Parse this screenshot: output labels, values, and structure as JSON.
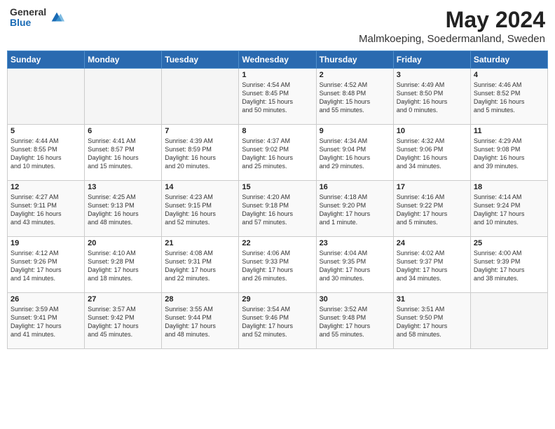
{
  "header": {
    "logo_general": "General",
    "logo_blue": "Blue",
    "month_title": "May 2024",
    "location": "Malmkoeping, Soedermanland, Sweden"
  },
  "days_of_week": [
    "Sunday",
    "Monday",
    "Tuesday",
    "Wednesday",
    "Thursday",
    "Friday",
    "Saturday"
  ],
  "weeks": [
    [
      {
        "day": "",
        "text": ""
      },
      {
        "day": "",
        "text": ""
      },
      {
        "day": "",
        "text": ""
      },
      {
        "day": "1",
        "text": "Sunrise: 4:54 AM\nSunset: 8:45 PM\nDaylight: 15 hours\nand 50 minutes."
      },
      {
        "day": "2",
        "text": "Sunrise: 4:52 AM\nSunset: 8:48 PM\nDaylight: 15 hours\nand 55 minutes."
      },
      {
        "day": "3",
        "text": "Sunrise: 4:49 AM\nSunset: 8:50 PM\nDaylight: 16 hours\nand 0 minutes."
      },
      {
        "day": "4",
        "text": "Sunrise: 4:46 AM\nSunset: 8:52 PM\nDaylight: 16 hours\nand 5 minutes."
      }
    ],
    [
      {
        "day": "5",
        "text": "Sunrise: 4:44 AM\nSunset: 8:55 PM\nDaylight: 16 hours\nand 10 minutes."
      },
      {
        "day": "6",
        "text": "Sunrise: 4:41 AM\nSunset: 8:57 PM\nDaylight: 16 hours\nand 15 minutes."
      },
      {
        "day": "7",
        "text": "Sunrise: 4:39 AM\nSunset: 8:59 PM\nDaylight: 16 hours\nand 20 minutes."
      },
      {
        "day": "8",
        "text": "Sunrise: 4:37 AM\nSunset: 9:02 PM\nDaylight: 16 hours\nand 25 minutes."
      },
      {
        "day": "9",
        "text": "Sunrise: 4:34 AM\nSunset: 9:04 PM\nDaylight: 16 hours\nand 29 minutes."
      },
      {
        "day": "10",
        "text": "Sunrise: 4:32 AM\nSunset: 9:06 PM\nDaylight: 16 hours\nand 34 minutes."
      },
      {
        "day": "11",
        "text": "Sunrise: 4:29 AM\nSunset: 9:08 PM\nDaylight: 16 hours\nand 39 minutes."
      }
    ],
    [
      {
        "day": "12",
        "text": "Sunrise: 4:27 AM\nSunset: 9:11 PM\nDaylight: 16 hours\nand 43 minutes."
      },
      {
        "day": "13",
        "text": "Sunrise: 4:25 AM\nSunset: 9:13 PM\nDaylight: 16 hours\nand 48 minutes."
      },
      {
        "day": "14",
        "text": "Sunrise: 4:23 AM\nSunset: 9:15 PM\nDaylight: 16 hours\nand 52 minutes."
      },
      {
        "day": "15",
        "text": "Sunrise: 4:20 AM\nSunset: 9:18 PM\nDaylight: 16 hours\nand 57 minutes."
      },
      {
        "day": "16",
        "text": "Sunrise: 4:18 AM\nSunset: 9:20 PM\nDaylight: 17 hours\nand 1 minute."
      },
      {
        "day": "17",
        "text": "Sunrise: 4:16 AM\nSunset: 9:22 PM\nDaylight: 17 hours\nand 5 minutes."
      },
      {
        "day": "18",
        "text": "Sunrise: 4:14 AM\nSunset: 9:24 PM\nDaylight: 17 hours\nand 10 minutes."
      }
    ],
    [
      {
        "day": "19",
        "text": "Sunrise: 4:12 AM\nSunset: 9:26 PM\nDaylight: 17 hours\nand 14 minutes."
      },
      {
        "day": "20",
        "text": "Sunrise: 4:10 AM\nSunset: 9:28 PM\nDaylight: 17 hours\nand 18 minutes."
      },
      {
        "day": "21",
        "text": "Sunrise: 4:08 AM\nSunset: 9:31 PM\nDaylight: 17 hours\nand 22 minutes."
      },
      {
        "day": "22",
        "text": "Sunrise: 4:06 AM\nSunset: 9:33 PM\nDaylight: 17 hours\nand 26 minutes."
      },
      {
        "day": "23",
        "text": "Sunrise: 4:04 AM\nSunset: 9:35 PM\nDaylight: 17 hours\nand 30 minutes."
      },
      {
        "day": "24",
        "text": "Sunrise: 4:02 AM\nSunset: 9:37 PM\nDaylight: 17 hours\nand 34 minutes."
      },
      {
        "day": "25",
        "text": "Sunrise: 4:00 AM\nSunset: 9:39 PM\nDaylight: 17 hours\nand 38 minutes."
      }
    ],
    [
      {
        "day": "26",
        "text": "Sunrise: 3:59 AM\nSunset: 9:41 PM\nDaylight: 17 hours\nand 41 minutes."
      },
      {
        "day": "27",
        "text": "Sunrise: 3:57 AM\nSunset: 9:42 PM\nDaylight: 17 hours\nand 45 minutes."
      },
      {
        "day": "28",
        "text": "Sunrise: 3:55 AM\nSunset: 9:44 PM\nDaylight: 17 hours\nand 48 minutes."
      },
      {
        "day": "29",
        "text": "Sunrise: 3:54 AM\nSunset: 9:46 PM\nDaylight: 17 hours\nand 52 minutes."
      },
      {
        "day": "30",
        "text": "Sunrise: 3:52 AM\nSunset: 9:48 PM\nDaylight: 17 hours\nand 55 minutes."
      },
      {
        "day": "31",
        "text": "Sunrise: 3:51 AM\nSunset: 9:50 PM\nDaylight: 17 hours\nand 58 minutes."
      },
      {
        "day": "",
        "text": ""
      }
    ]
  ]
}
